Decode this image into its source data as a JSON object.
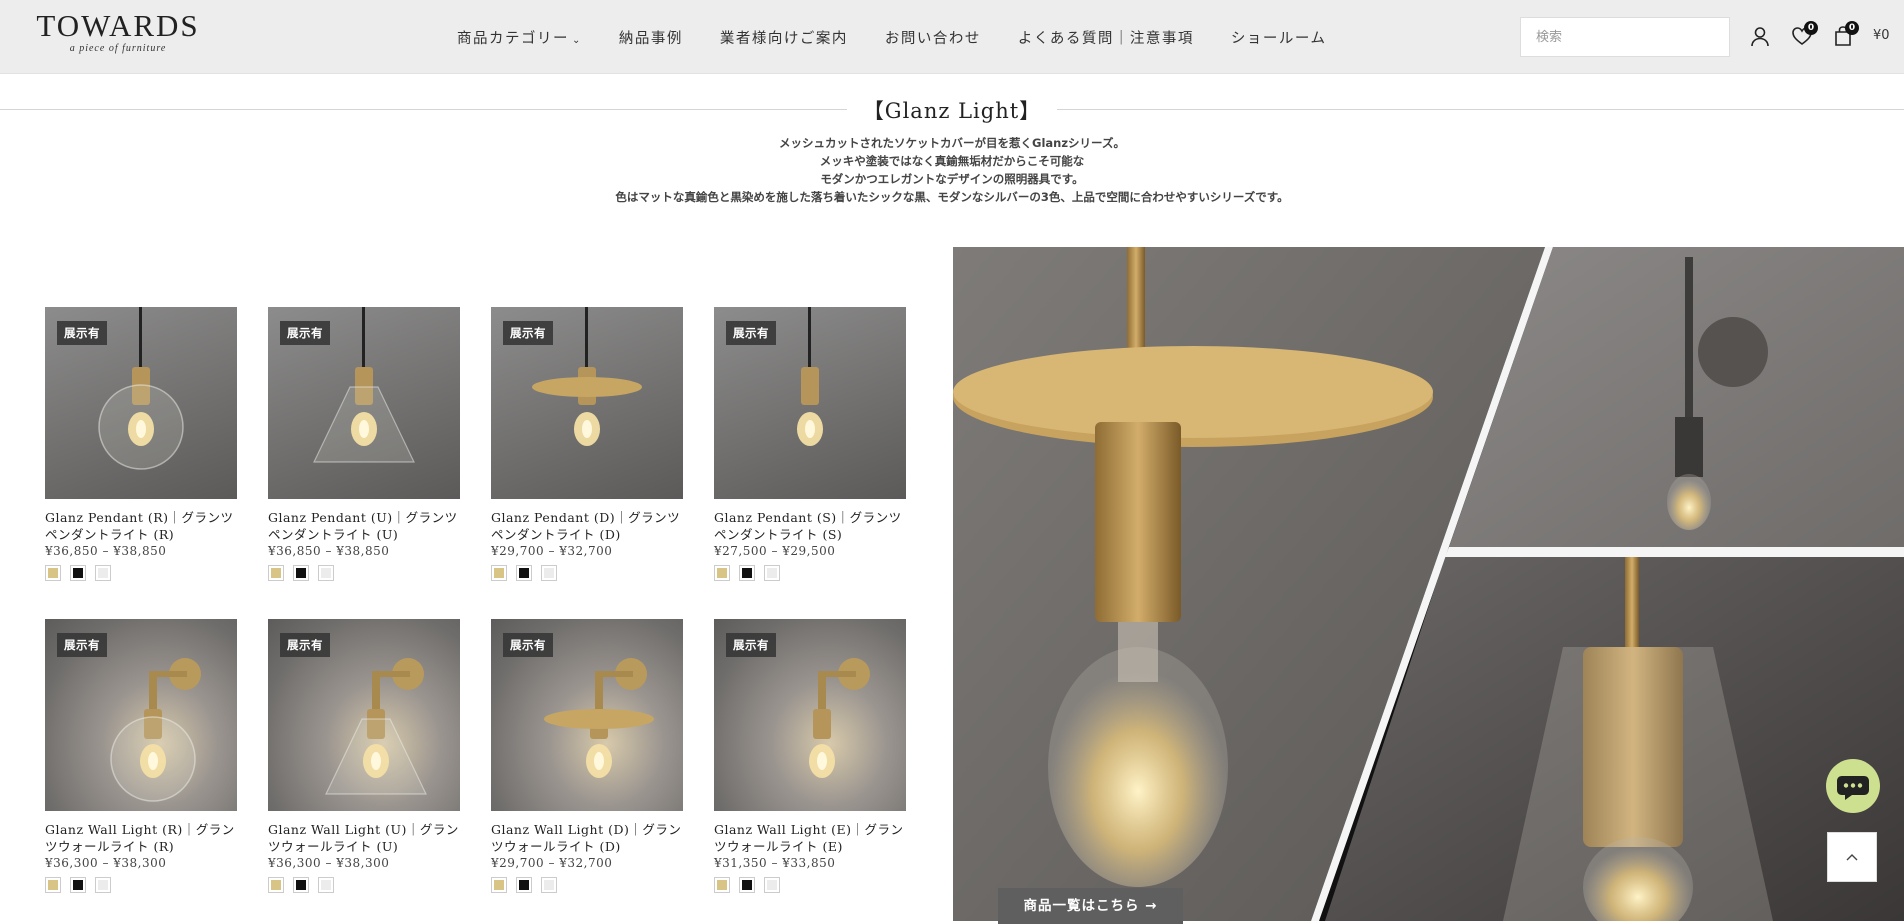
{
  "brand": {
    "name": "TOWARDS",
    "tagline": "a piece of furniture"
  },
  "nav": {
    "items": [
      {
        "label": "商品カテゴリー",
        "has_dropdown": true
      },
      {
        "label": "納品事例"
      },
      {
        "label": "業者様向けご案内"
      },
      {
        "label": "お問い合わせ"
      },
      {
        "label": "よくある質問｜注意事項"
      },
      {
        "label": "ショールーム"
      }
    ]
  },
  "header": {
    "search_placeholder": "検索",
    "icons": [
      "user-icon",
      "heart-icon",
      "cart-icon"
    ],
    "wishlist_count": "0",
    "cart_count": "0",
    "cart_total": "¥0"
  },
  "section": {
    "title": "【Glanz Light】",
    "description": [
      "メッシュカットされたソケットカバーが目を惹くGlanzシリーズ。",
      "メッキや塗装ではなく真鍮無垢材だからこそ可能な",
      "モダンかつエレガントなデザインの照明器具です。",
      "色はマットな真鍮色と黒染めを施した落ち着いたシックな黒、モダンなシルバーの3色、上品で空間に合わせやすいシリーズです。"
    ]
  },
  "colors": {
    "gold": "#d8c585",
    "black": "#111111",
    "silver": "#ececec",
    "chat": "#cde08f"
  },
  "products": [
    {
      "badge": "展示有",
      "name_line1": "Glanz Pendant (R)｜グランツ",
      "name_line2": "ペンダントライト (R)",
      "price": "¥36,850 – ¥38,850",
      "type": "pendant-globe"
    },
    {
      "badge": "展示有",
      "name_line1": "Glanz Pendant (U)｜グランツ",
      "name_line2": "ペンダントライト (U)",
      "price": "¥36,850 – ¥38,850",
      "type": "pendant-cone"
    },
    {
      "badge": "展示有",
      "name_line1": "Glanz Pendant (D)｜グランツ",
      "name_line2": "ペンダントライト (D)",
      "price": "¥29,700 – ¥32,700",
      "type": "pendant-disc"
    },
    {
      "badge": "展示有",
      "name_line1": "Glanz Pendant (S)｜グランツ",
      "name_line2": "ペンダントライト (S)",
      "price": "¥27,500 – ¥29,500",
      "type": "pendant-bare"
    },
    {
      "badge": "展示有",
      "name_line1": "Glanz Wall Light (R)｜グラン",
      "name_line2": "ツウォールライト (R)",
      "price": "¥36,300 – ¥38,300",
      "type": "wall-globe"
    },
    {
      "badge": "展示有",
      "name_line1": "Glanz Wall Light (U)｜グラン",
      "name_line2": "ツウォールライト (U)",
      "price": "¥36,300 – ¥38,300",
      "type": "wall-cone"
    },
    {
      "badge": "展示有",
      "name_line1": "Glanz Wall Light (D)｜グラン",
      "name_line2": "ツウォールライト (D)",
      "price": "¥29,700 – ¥32,700",
      "type": "wall-disc"
    },
    {
      "badge": "展示有",
      "name_line1": "Glanz Wall Light (E)｜グラン",
      "name_line2": "ツウォールライト (E)",
      "price": "¥31,350 – ¥33,850",
      "type": "wall-bare"
    }
  ],
  "hero": {
    "cta_label": "商品一覧はこちら",
    "cta_arrow": "→"
  },
  "floating": {
    "chat_icon": "chat-bubble-icon",
    "back_to_top_icon": "chevron-up-icon"
  }
}
